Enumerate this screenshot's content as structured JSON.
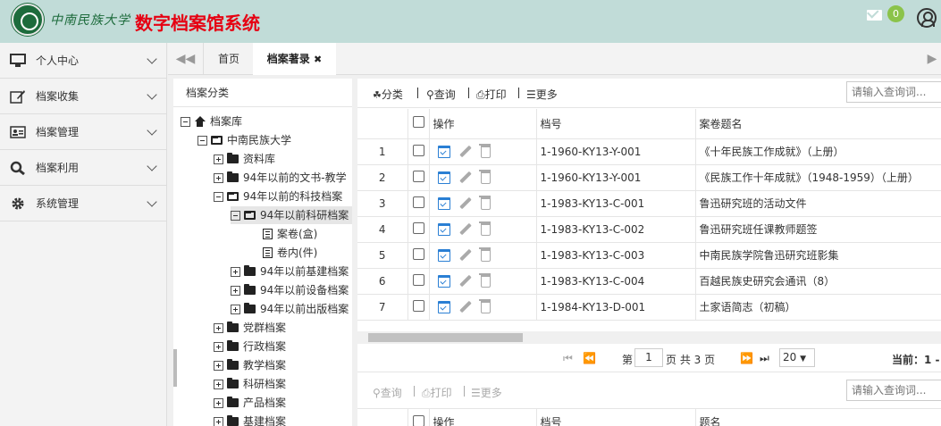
{
  "header": {
    "university_name": "中南民族大学",
    "app_title": "数字档案馆系统",
    "mail_count": "0"
  },
  "sidebar": {
    "items": [
      {
        "label": "个人中心",
        "icon": "monitor-icon"
      },
      {
        "label": "档案收集",
        "icon": "edit-icon"
      },
      {
        "label": "档案管理",
        "icon": "id-card-icon"
      },
      {
        "label": "档案利用",
        "icon": "search-icon"
      },
      {
        "label": "系统管理",
        "icon": "gear-icon"
      }
    ]
  },
  "tabs": {
    "prev": "◀◀",
    "home": "首页",
    "active": "档案著录",
    "close": "✖",
    "next": "▶"
  },
  "tree": {
    "title": "档案分类",
    "nodes": [
      {
        "label": "档案库"
      },
      {
        "label": "中南民族大学"
      },
      {
        "label": "资料库"
      },
      {
        "label": "94年以前的文书-教学"
      },
      {
        "label": "94年以前的科技档案"
      },
      {
        "label": "94年以前科研档案"
      },
      {
        "label": "案卷(盒)"
      },
      {
        "label": "卷内(件)"
      },
      {
        "label": "94年以前基建档案"
      },
      {
        "label": "94年以前设备档案"
      },
      {
        "label": "94年以前出版档案"
      },
      {
        "label": "党群档案"
      },
      {
        "label": "行政档案"
      },
      {
        "label": "教学档案"
      },
      {
        "label": "科研档案"
      },
      {
        "label": "产品档案"
      },
      {
        "label": "基建档案"
      }
    ]
  },
  "toolbar": {
    "classify": "分类",
    "query": "查询",
    "print": "打印",
    "more": "更多",
    "search_placeholder": "请输入查询词..."
  },
  "grid": {
    "columns": [
      "操作",
      "档号",
      "案卷题名"
    ],
    "rows": [
      {
        "n": "1",
        "code": "1-1960-KY13-Y-001",
        "title": "《十年民族工作成就》（上册）"
      },
      {
        "n": "2",
        "code": "1-1960-KY13-Y-001",
        "title": "《民族工作十年成就》（1948-1959）（上册）"
      },
      {
        "n": "3",
        "code": "1-1983-KY13-C-001",
        "title": "鲁迅研究班的活动文件"
      },
      {
        "n": "4",
        "code": "1-1983-KY13-C-002",
        "title": "鲁迅研究班任课教师题签"
      },
      {
        "n": "5",
        "code": "1-1983-KY13-C-003",
        "title": "中南民族学院鲁迅研究班影集"
      },
      {
        "n": "6",
        "code": "1-1983-KY13-C-004",
        "title": "百越民族史研究会通讯（8）"
      },
      {
        "n": "7",
        "code": "1-1984-KY13-D-001",
        "title": "土家语简志（初稿）"
      }
    ]
  },
  "pager": {
    "page_prefix": "第",
    "page": "1",
    "page_suffix": "页 共 3 页",
    "page_size": "20",
    "current": "当前：1 -"
  },
  "toolbar2": {
    "query": "查询",
    "print": "打印",
    "more": "更多",
    "search_placeholder": "请输入查询词..."
  },
  "grid2": {
    "columns": [
      "操作",
      "档号",
      "题名"
    ]
  }
}
